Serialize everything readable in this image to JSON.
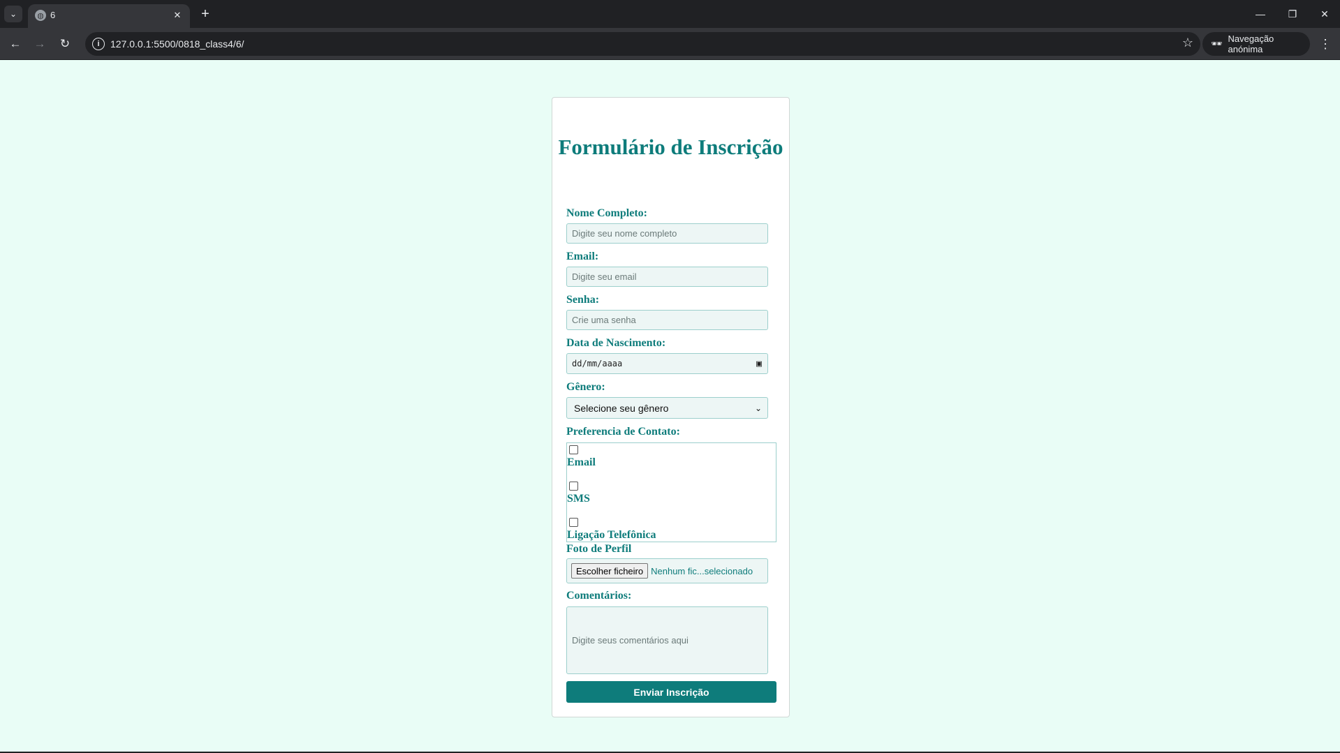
{
  "browser": {
    "tab_list_icon": "chevron-down-icon",
    "tab": {
      "title": "6",
      "icon": "globe-icon",
      "close": "✕"
    },
    "new_tab": "+",
    "window": {
      "minimize": "—",
      "restore": "❐",
      "close": "✕"
    },
    "url": "127.0.0.1:5500/0818_class4/6/",
    "incognito_label": "Navegação anónima"
  },
  "form": {
    "title": "Formulário de Inscrição",
    "name": {
      "label": "Nome Completo:",
      "placeholder": "Digite seu nome completo"
    },
    "email": {
      "label": "Email:",
      "placeholder": "Digite seu email"
    },
    "password": {
      "label": "Senha:",
      "placeholder": "Crie uma senha"
    },
    "birthdate": {
      "label": "Data de Nascimento:",
      "placeholder": "dd/mm/aaaa"
    },
    "gender": {
      "label": "Gênero:",
      "selected": "Selecione seu gênero"
    },
    "contact": {
      "label": "Preferencia de Contato:",
      "options": [
        {
          "label": "Email",
          "checked": false
        },
        {
          "label": "SMS",
          "checked": false
        },
        {
          "label": "Ligação Telefônica",
          "checked": false
        }
      ]
    },
    "photo": {
      "label": "Foto de Perfil",
      "button": "Escolher ficheiro",
      "status": "Nenhum fic...selecionado"
    },
    "comments": {
      "label": "Comentários:",
      "placeholder": "Digite seus comentários aqui"
    },
    "submit_label": "Enviar Inscrição"
  },
  "colors": {
    "page_bg": "#e9fdf6",
    "accent": "#0e7c7b",
    "field_bg": "#edf6f5"
  }
}
